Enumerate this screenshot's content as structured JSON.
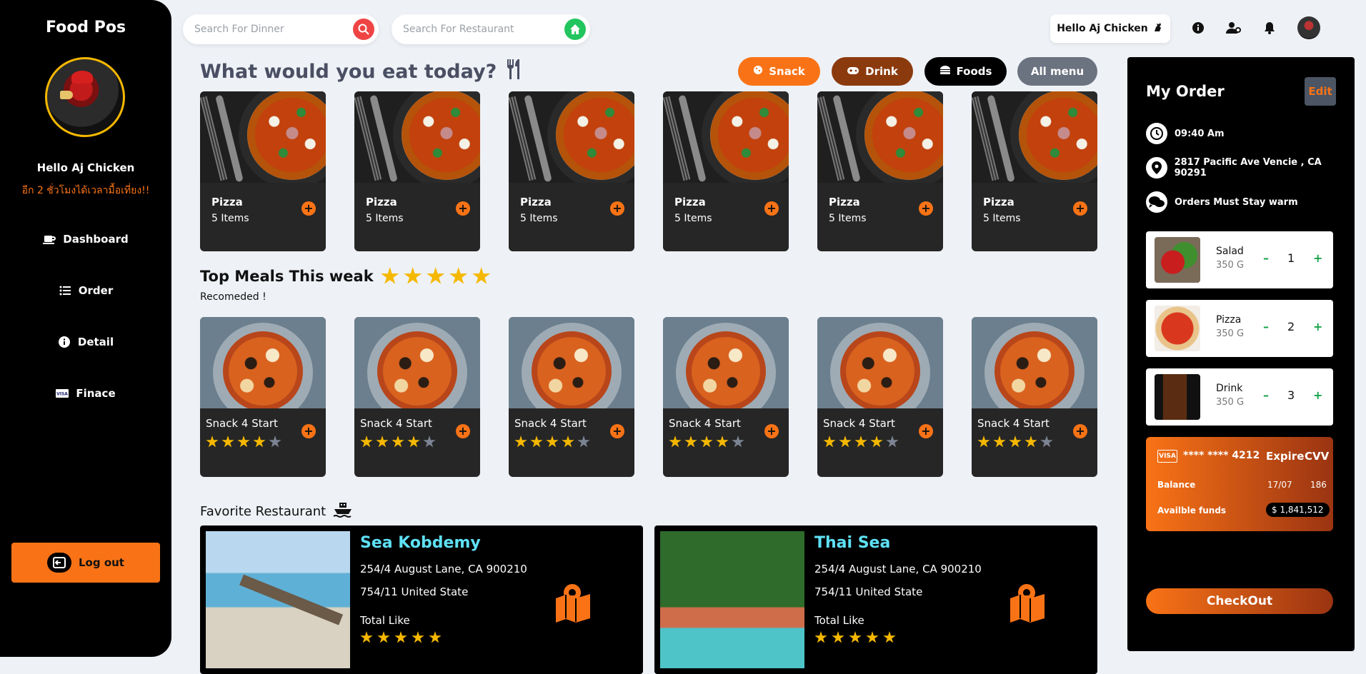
{
  "app": {
    "brand": "Food Pos"
  },
  "sidebar": {
    "greeting": "Hello Aj Chicken",
    "subtitle": "อีก 2 ชั่วโมงได้เวลามื้อเที่ยง!!",
    "items": [
      {
        "label": "Dashboard",
        "icon": "coffee-cup-icon"
      },
      {
        "label": "Order",
        "icon": "list-icon"
      },
      {
        "label": "Detail",
        "icon": "info-icon"
      },
      {
        "label": "Finace",
        "icon": "visa-card-icon"
      }
    ],
    "logout_label": "Log out"
  },
  "search": {
    "dinner_placeholder": "Search For Dinner",
    "restaurant_placeholder": "Search For Restaurant"
  },
  "header": {
    "hello": "Hello Aj Chicken",
    "icons": [
      "info-icon",
      "user-settings-icon",
      "bell-icon"
    ]
  },
  "main": {
    "heading": "What would you eat today?",
    "chips": [
      {
        "label": "Snack",
        "color": "#f97316"
      },
      {
        "label": "Drink",
        "color": "#8b3a0e"
      },
      {
        "label": "Foods",
        "color": "#000000"
      },
      {
        "label": "All menu",
        "color": "#6b7280"
      }
    ],
    "categories": [
      {
        "title": "Pizza",
        "count": "5 Items"
      },
      {
        "title": "Pizza",
        "count": "5 Items"
      },
      {
        "title": "Pizza",
        "count": "5 Items"
      },
      {
        "title": "Pizza",
        "count": "5 Items"
      },
      {
        "title": "Pizza",
        "count": "5 Items"
      },
      {
        "title": "Pizza",
        "count": "5 Items"
      }
    ],
    "top_heading": "Top Meals This weak",
    "top_heading_stars": 5,
    "recommended": "Recomeded !",
    "meals": [
      {
        "title": "Snack 4 Start",
        "rating": 4
      },
      {
        "title": "Snack 4 Start",
        "rating": 4
      },
      {
        "title": "Snack 4 Start",
        "rating": 4
      },
      {
        "title": "Snack 4 Start",
        "rating": 4
      },
      {
        "title": "Snack 4 Start",
        "rating": 4
      },
      {
        "title": "Snack 4 Start",
        "rating": 4
      }
    ],
    "favorite_heading": "Favorite Restaurant",
    "restaurants": [
      {
        "name": "Sea Kobdemy",
        "address1": "254/4 August Lane, CA 900210",
        "address2": "754/11 United State",
        "like_label": "Total Like",
        "rating": 5
      },
      {
        "name": "Thai Sea",
        "address1": "254/4 August Lane, CA 900210",
        "address2": "754/11 United State",
        "like_label": "Total Like",
        "rating": 5
      }
    ]
  },
  "order": {
    "title": "My Order",
    "edit_label": "Edit",
    "time": "09:40 Am",
    "address": "2817 Pacific Ave Vencie , CA 90291",
    "note": "Orders Must Stay warm",
    "items": [
      {
        "name": "Salad",
        "weight": "350 G",
        "qty": "1"
      },
      {
        "name": "Pizza",
        "weight": "350 G",
        "qty": "2"
      },
      {
        "name": "Drink",
        "weight": "350 G",
        "qty": "3"
      }
    ],
    "card": {
      "brand": "VISA",
      "number": "**** **** 4212",
      "expire_label": "Expire",
      "cvv_label": "CVV",
      "balance_label": "Balance",
      "expire_value": "17/07",
      "cvv_value": "186",
      "funds_label": "Availble funds",
      "funds_value": "$ 1,841,512"
    },
    "checkout_label": "CheckOut"
  },
  "colors": {
    "accent": "#f97316",
    "sidebar": "#000000",
    "background": "#eef1f6",
    "star": "#f5b800",
    "restaurant_name": "#5ee0f5"
  }
}
